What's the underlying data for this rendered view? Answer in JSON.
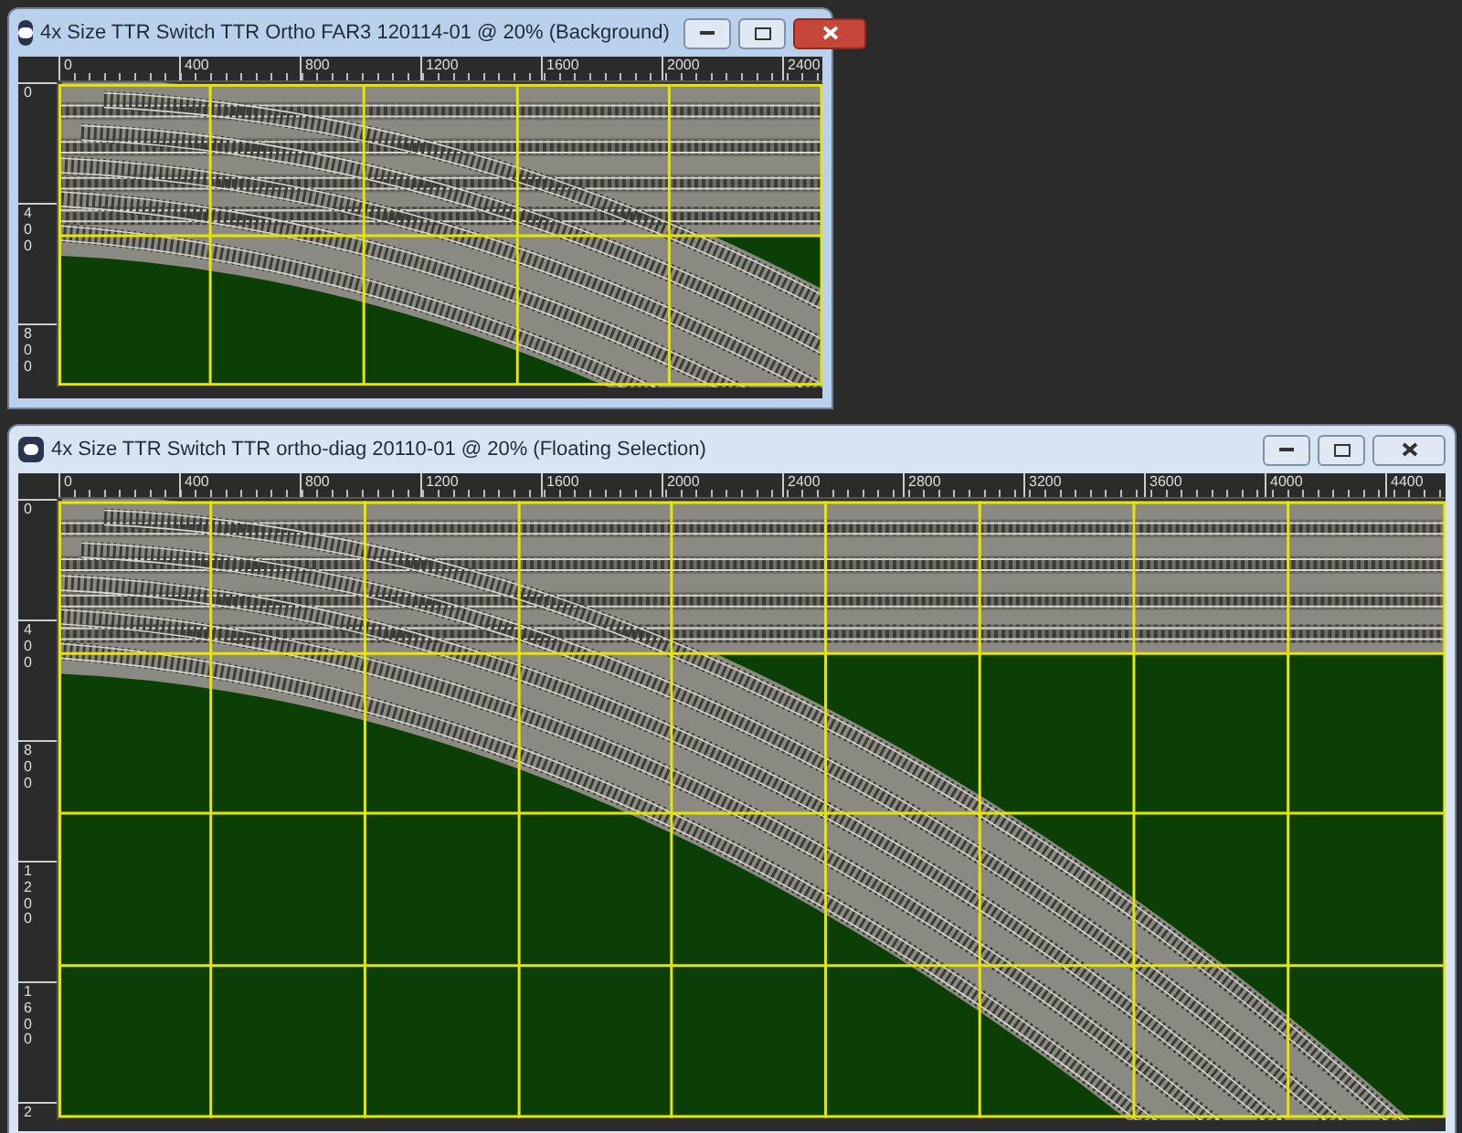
{
  "windows": [
    {
      "title": "4x Size TTR Switch TTR Ortho FAR3 120114-01 @  20% (Background)",
      "active": true,
      "horizontal_ruler": [
        "0",
        "400",
        "800",
        "1200",
        "1600",
        "2000",
        "2400"
      ],
      "vertical_ruler": [
        "0",
        "400",
        "800"
      ]
    },
    {
      "title": "4x Size TTR Switch TTR ortho-diag 20110-01 @  20% (Floating Selection)",
      "active": false,
      "horizontal_ruler": [
        "0",
        "400",
        "800",
        "1200",
        "1600",
        "2000",
        "2400",
        "2800",
        "3200",
        "3600",
        "4000",
        "4400"
      ],
      "vertical_ruler": [
        "0",
        "400",
        "800",
        "1200",
        "1600",
        "2"
      ]
    }
  ]
}
